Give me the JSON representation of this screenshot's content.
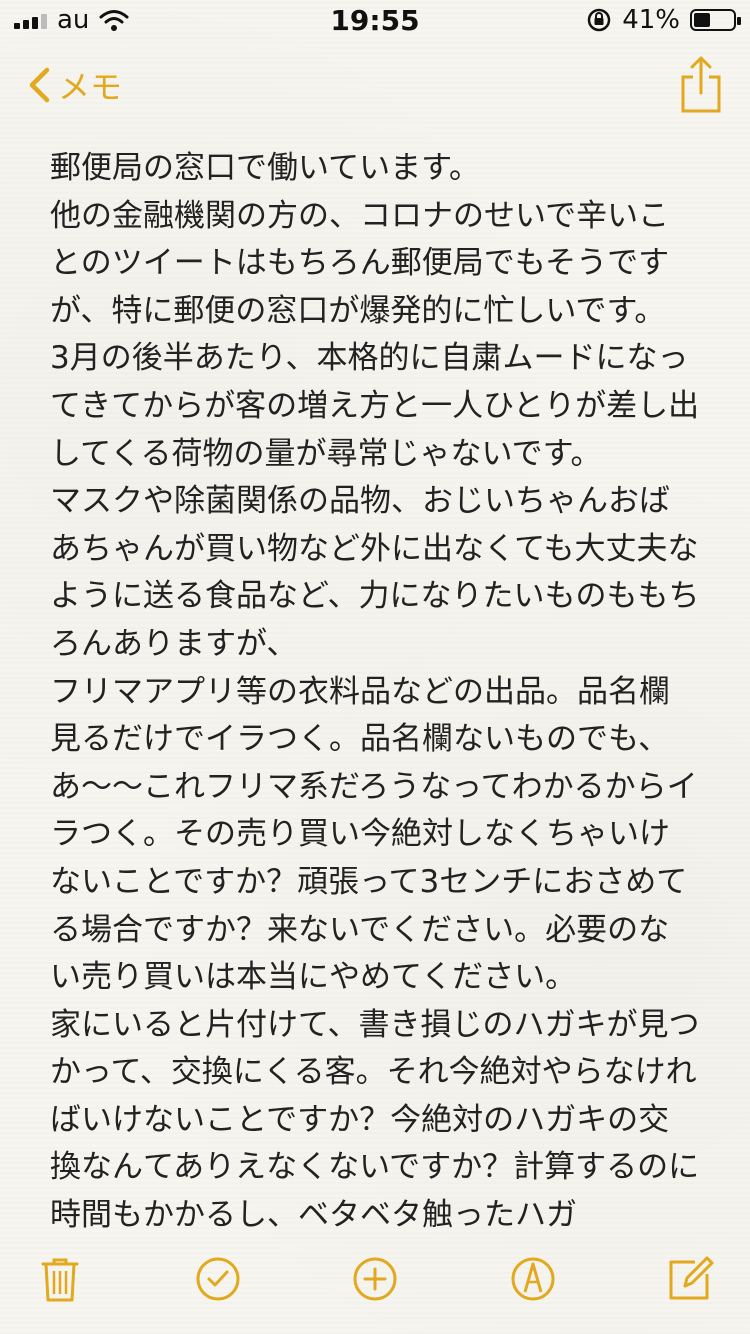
{
  "status_bar": {
    "carrier": "au",
    "time": "19:55",
    "battery_percent": "41%",
    "battery_level": 0.41
  },
  "nav": {
    "back_label": "メモ"
  },
  "note": {
    "text": "郵便局の窓口で働いています。\n他の金融機関の方の、コロナのせいで辛いことのツイートはもちろん郵便局でもそうですが、特に郵便の窓口が爆発的に忙しいです。\n3月の後半あたり、本格的に自粛ムードになってきてからが客の増え方と一人ひとりが差し出してくる荷物の量が尋常じゃないです。\nマスクや除菌関係の品物、おじいちゃんおばあちゃんが買い物など外に出なくても大丈夫なように送る食品など、力になりたいものももちろんありますが、\nフリマアプリ等の衣料品などの出品。品名欄見るだけでイラつく。品名欄ないものでも、あ〜〜これフリマ系だろうなってわかるからイラつく。その売り買い今絶対しなくちゃいけないことですか？頑張って3センチにおさめてる場合ですか？来ないでください。必要のない売り買いは本当にやめてください。\n家にいると片付けて、書き損じのハガキが見つかって、交換にくる客。それ今絶対やらなければいけないことですか？今絶対のハガキの交換なんてありえなくないですか？計算するのに時間もかかるし、ベタベタ触ったハガ"
  },
  "toolbar": {
    "icons": [
      "trash-icon",
      "checklist-icon",
      "add-icon",
      "markup-icon",
      "compose-icon"
    ]
  },
  "colors": {
    "accent": "#e2a81e",
    "text": "#222222",
    "background": "#f7f5f0"
  }
}
